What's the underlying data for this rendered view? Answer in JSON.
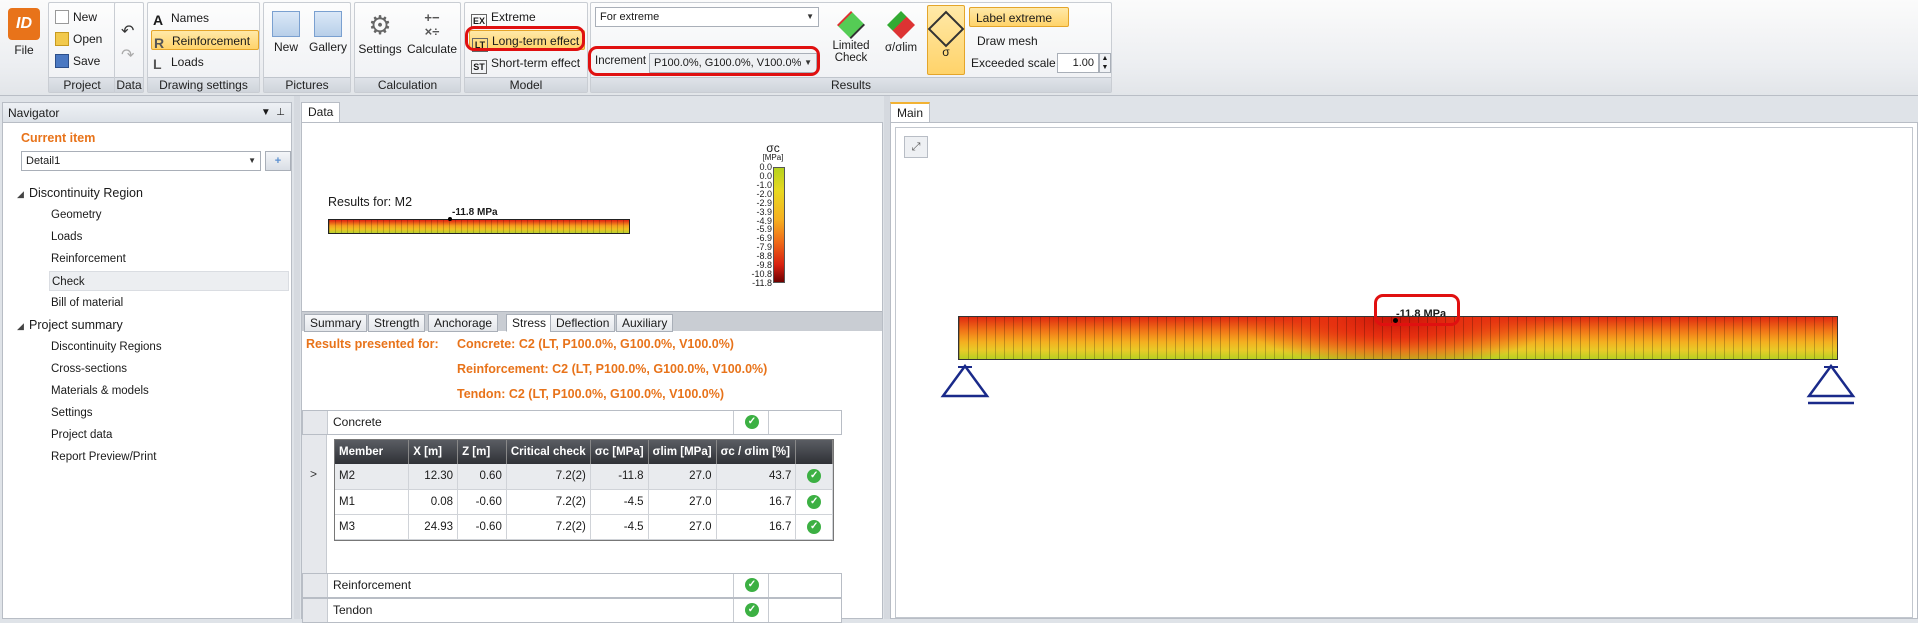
{
  "ribbon": {
    "file_label": "File",
    "project": {
      "group_label": "Project",
      "new_label": "New",
      "open_label": "Open",
      "save_label": "Save"
    },
    "data": {
      "group_label": "Data"
    },
    "drawing_settings": {
      "group_label": "Drawing settings",
      "names_label": "Names",
      "reinforcement_label": "Reinforcement",
      "loads_label": "Loads"
    },
    "pictures": {
      "group_label": "Pictures",
      "new_label": "New",
      "gallery_label": "Gallery"
    },
    "calculation": {
      "group_label": "Calculation",
      "settings_label": "Settings",
      "calculate_label": "Calculate"
    },
    "model": {
      "group_label": "Model",
      "extreme_label": "Extreme",
      "long_term_label": "Long-term effect",
      "short_term_label": "Short-term effect",
      "ex_tag": "EX",
      "lt_tag": "LT",
      "st_tag": "ST"
    },
    "results": {
      "group_label": "Results",
      "mode_value": "For extreme",
      "increment_label": "Increment",
      "increment_value": "P100.0%, G100.0%, V100.0%",
      "limited_check_label_1": "Limited",
      "limited_check_label_2": "Check",
      "sigma_olim_label": "σ/σlim",
      "sigma_label": "σ",
      "label_extreme_label": "Label extreme",
      "draw_mesh_label": "Draw mesh",
      "exceeded_scale_label": "Exceeded scale",
      "exceeded_scale_value": "1.00"
    }
  },
  "navigator": {
    "title": "Navigator",
    "current_item_label": "Current item",
    "current_item_value": "Detail1",
    "tree": [
      {
        "label": "Discontinuity Region",
        "level": 0
      },
      {
        "label": "Geometry",
        "level": 1
      },
      {
        "label": "Loads",
        "level": 1
      },
      {
        "label": "Reinforcement",
        "level": 1
      },
      {
        "label": "Check",
        "level": 1,
        "selected": true
      },
      {
        "label": "Bill of material",
        "level": 1
      },
      {
        "label": "Project summary",
        "level": 0
      },
      {
        "label": "Discontinuity Regions",
        "level": 1
      },
      {
        "label": "Cross-sections",
        "level": 1
      },
      {
        "label": "Materials & models",
        "level": 1
      },
      {
        "label": "Settings",
        "level": 1
      },
      {
        "label": "Project data",
        "level": 1
      },
      {
        "label": "Report Preview/Print",
        "level": 1
      }
    ]
  },
  "data_pane": {
    "tab_label": "Data",
    "results_for": "Results for: M2",
    "small_beam_label": "-11.8 MPa",
    "legend": {
      "title": "σc",
      "unit": "[MPa]",
      "ticks": [
        "0.0",
        "0.0",
        "-1.0",
        "-2.0",
        "-2.9",
        "-3.9",
        "-4.9",
        "-5.9",
        "-6.9",
        "-7.9",
        "-8.8",
        "-9.8",
        "-10.8",
        "-11.8"
      ]
    },
    "subtabs": [
      "Summary",
      "Strength",
      "Anchorage",
      "Stress",
      "Deflection",
      "Auxiliary"
    ],
    "active_subtab": "Stress",
    "results_presented_label": "Results presented for:",
    "results_presented": [
      "Concrete: C2 (LT, P100.0%, G100.0%, V100.0%)",
      "Reinforcement: C2 (LT, P100.0%, G100.0%, V100.0%)",
      "Tendon: C2 (LT, P100.0%, G100.0%, V100.0%)"
    ],
    "sections": {
      "concrete": "Concrete",
      "reinforcement": "Reinforcement",
      "tendon": "Tendon"
    },
    "table": {
      "headers": [
        "Member",
        "X [m]",
        "Z [m]",
        "Critical check",
        "σc [MPa]",
        "σlim [MPa]",
        "σc / σlim [%]",
        ""
      ],
      "rows": [
        [
          "M2",
          "12.30",
          "0.60",
          "7.2(2)",
          "-11.8",
          "27.0",
          "43.7"
        ],
        [
          "M1",
          "0.08",
          "-0.60",
          "7.2(2)",
          "-4.5",
          "27.0",
          "16.7"
        ],
        [
          "M3",
          "24.93",
          "-0.60",
          "7.2(2)",
          "-4.5",
          "27.0",
          "16.7"
        ]
      ]
    },
    "row_marker": ">"
  },
  "main_pane": {
    "tab_label": "Main",
    "beam_label": "-11.8 MPa"
  },
  "colors": {
    "accent_orange": "#e8731a",
    "highlight_red": "#e01010",
    "check_green": "#3cb043",
    "support_blue": "#1a2a8a"
  }
}
